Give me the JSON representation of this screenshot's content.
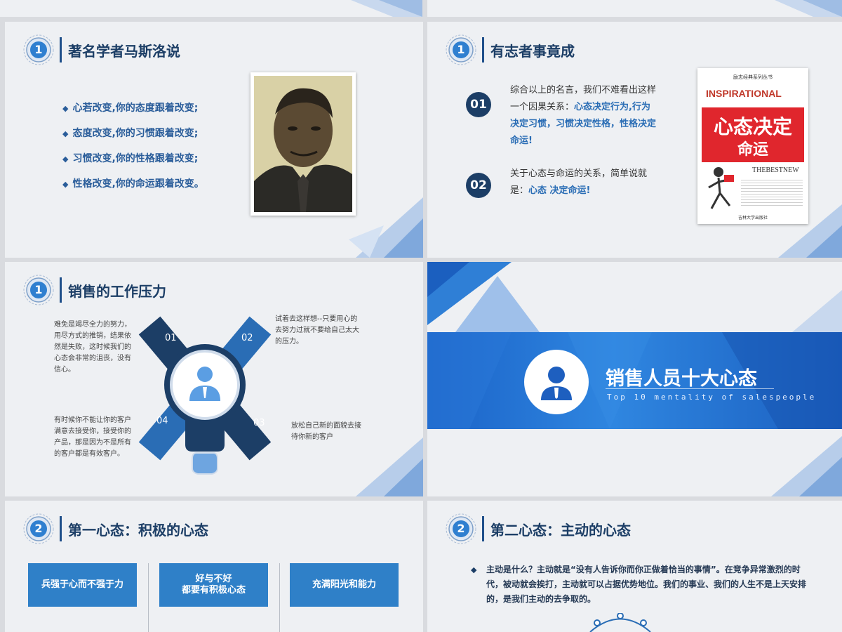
{
  "slide1": {
    "badge": "1",
    "title": "著名学者马斯洛说",
    "bullets": [
      "心若改变,你的态度跟着改变;",
      "态度改变,你的习惯跟着改变;",
      "习惯改变,你的性格跟着改变;",
      "性格改变,你的命运跟着改变。"
    ]
  },
  "slide2": {
    "badge": "1",
    "title": "有志者事竟成",
    "items": [
      {
        "num": "01",
        "text_a": "综合以上的名言，我们不难看出这样一个因果关系：",
        "text_hl": "心态决定行为,行为决定习惯，习惯决定性格，性格决定命运!"
      },
      {
        "num": "02",
        "text_a": "关于心态与命运的关系，简单说就是：",
        "text_hl": "心态 决定命运!"
      }
    ],
    "book": {
      "series": "励志经典系列丛书",
      "brand": "INSPIRATIONAL",
      "title_line1": "心态决定",
      "title_line2": "命运",
      "tag": "THEBESTNEW",
      "publisher": "吉林大学出版社"
    }
  },
  "slide3": {
    "badge": "1",
    "title": "销售的工作压力",
    "petals": [
      "01",
      "02",
      "03",
      "04"
    ],
    "texts": {
      "t01": "难免是竭尽全力的努力，用尽方式的推销，结果依然是失败，这时候我们的心态会非常的沮丧，没有信心。",
      "t02": "试着去这样想--只要用心的去努力过就不要给自己太大的压力。",
      "t03": "放松自己新的面貌去接待你新的客户",
      "t04": "有时候你不能让你的客户满意去接受你，接受你的产品，那是因为不是所有的客户都是有效客户。"
    }
  },
  "slide4": {
    "title": "销售人员十大心态",
    "subtitle": "Top 10 mentality of salespeople"
  },
  "slide5": {
    "badge": "2",
    "title": "第一心态：积极的心态",
    "boxes": [
      "兵强于心而不强于力",
      "好与不好\n都要有积极心态",
      "充满阳光和能力"
    ]
  },
  "slide6": {
    "badge": "2",
    "title": "第二心态：主动的心态",
    "paragraph": "主动是什么？主动就是“没有人告诉你而你正做着恰当的事情”。在竞争异常激烈的时代，被动就会挨打，主动就可以占据优势地位。我们的事业、我们的人生不是上天安排的，是我们主动的去争取的。"
  },
  "colors": {
    "navy": "#1c3e66",
    "accent": "#2a6db5",
    "button": "#2f80c8",
    "banner": "#1b63c8"
  }
}
